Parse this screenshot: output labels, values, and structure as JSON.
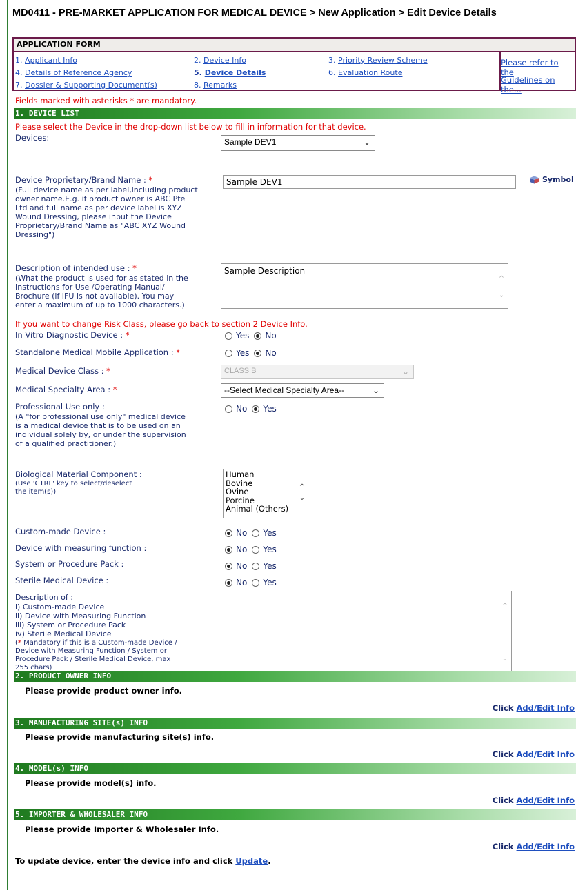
{
  "page": {
    "title": "MD0411 - PRE-MARKET APPLICATION FOR MEDICAL DEVICE > New Application > Edit Device Details"
  },
  "app_form": {
    "header": "APPLICATION FORM",
    "nav": [
      {
        "num": "1.",
        "label": "Applicant Info",
        "active": false
      },
      {
        "num": "2.",
        "label": "Device Info",
        "active": false
      },
      {
        "num": "3.",
        "label": "Priority Review Scheme",
        "active": false
      },
      {
        "num": "4.",
        "label": "Details of Reference Agency",
        "active": false
      },
      {
        "num": "5.",
        "label": "Device Details",
        "active": true
      },
      {
        "num": "6.",
        "label": "Evaluation Route",
        "active": false
      },
      {
        "num": "7.",
        "label": "Dossier & Supporting Document(s)",
        "active": false
      },
      {
        "num": "8.",
        "label": "Remarks",
        "active": false
      }
    ],
    "guideline_line1": "Please refer to the",
    "guideline_line2": "Guidelines on the..."
  },
  "mandatory_note": "Fields marked with asterisks * are mandatory.",
  "sections": {
    "device_list": "1. DEVICE LIST",
    "product_owner": "2. PRODUCT OWNER INFO",
    "manufacturing": "3. MANUFACTURING SITE(s) INFO",
    "models": "4. MODEL(s) INFO",
    "importer": "5. IMPORTER & WHOLESALER INFO"
  },
  "device_list": {
    "instruction": "Please select the Device in the drop-down list below to fill in information for that device.",
    "devices_label": "Devices:",
    "devices_value": "Sample DEV1",
    "brand_label": "Device Proprietary/Brand Name :",
    "brand_note_lines": [
      "(Full device name as per label,including product",
      "owner name.E.g. if product owner is ABC Pte",
      "Ltd and full name as per device label is XYZ",
      "Wound Dressing, please input the Device",
      "Proprietary/Brand Name as \"ABC XYZ Wound",
      "Dressing\")"
    ],
    "brand_value": "Sample DEV1",
    "symbol_label": "Symbol",
    "intended_use_label": "Description of intended use :",
    "intended_use_note_lines": [
      "(What the product is used for as stated in the",
      "Instructions for Use /Operating Manual/",
      "Brochure (if IFU is not available). You may",
      "enter a maximum of up to 1000 characters.)"
    ],
    "intended_use_value": "Sample Description",
    "risk_class_note": "If you want to change Risk Class, please go back to section 2 Device Info.",
    "ivd_label": "In Vitro Diagnostic Device :",
    "mobile_app_label": "Standalone Medical Mobile Application :",
    "device_class_label": "Medical Device Class :",
    "device_class_value": "CLASS B",
    "specialty_label": "Medical Specialty Area :",
    "specialty_value": "--Select Medical Specialty Area--",
    "professional_label": "Professional Use only :",
    "professional_note_lines": [
      "(A \"for professional use only\" medical device",
      "is a medical device that is to be used on an",
      "individual solely by, or under the supervision",
      "of a qualified practitioner.)"
    ],
    "bio_label": "Biological Material Component :",
    "bio_note_lines": [
      "(Use 'CTRL' key to select/deselect",
      "the item(s))"
    ],
    "bio_options": [
      "Human",
      "Bovine",
      "Ovine",
      "Porcine",
      "Animal (Others)"
    ],
    "custom_label": "Custom-made Device :",
    "measuring_label": "Device with measuring function :",
    "procedure_label": "System or Procedure Pack :",
    "sterile_label": "Sterile Medical Device :",
    "description_of_label": "Description of :",
    "description_of_lines": [
      "i) Custom-made Device",
      "ii) Device with Measuring Function",
      "iii) System or Procedure Pack",
      "iv) Sterile Medical Device"
    ],
    "description_of_note_lines": [
      "Mandatory if this is a Custom-made Device /",
      "Device with Measuring Function / System or",
      "Procedure Pack / Sterile Medical Device, max",
      "255 chars)"
    ],
    "yes": "Yes",
    "no": "No"
  },
  "product_owner": {
    "prompt": "Please provide product owner info."
  },
  "manufacturing": {
    "prompt": "Please provide manufacturing site(s) info."
  },
  "models": {
    "prompt": "Please provide model(s) info."
  },
  "importer": {
    "prompt": "Please provide Importer & Wholesaler Info."
  },
  "click_word": "Click",
  "add_edit_label": "Add/Edit Info",
  "footer": {
    "text": "To update device, enter the device info and click",
    "link": "Update",
    "period": "."
  }
}
